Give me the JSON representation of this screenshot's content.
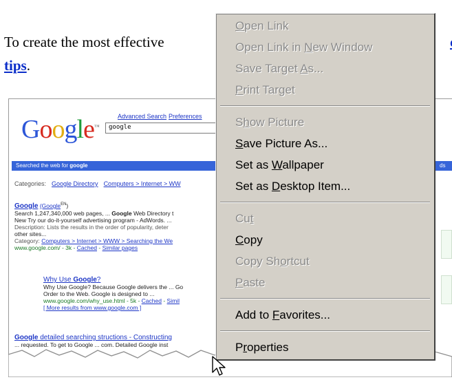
{
  "article": {
    "intro": "To create the most effective",
    "link_right": "or",
    "link_tips": "tips",
    "period": "."
  },
  "screenshot": {
    "logo_letters": [
      "G",
      "o",
      "o",
      "g",
      "l",
      "e"
    ],
    "tm": "™",
    "advanced_search": "Advanced Search",
    "preferences": "Preferences",
    "search_value": "google",
    "bar_prefix": "Searched the web for ",
    "bar_term": "google",
    "bar_right": "ds",
    "categories_label": "Categories:",
    "categories": [
      "Google Directory",
      "Computers > Internet > WW"
    ],
    "result1": {
      "title": "Google",
      "title_paren": "(Google",
      "title_sup": "EN",
      "line1_a": "Search 1,247,340,000 web pages, ... ",
      "line1_b": "Google",
      "line1_c": " Web Directory t",
      "line2": "New Try our do-it-yourself advertising program - AdWords. ...",
      "line3": "Description: Lists the results in the order of popularity, deter",
      "line4": "other sites...",
      "cat_label": "Category: ",
      "cat_link": "Computers > Internet > WWW > Searching the We",
      "url": "www.google.com/ - 3k - ",
      "cached": "Cached",
      "similar": "Similar pages"
    },
    "result2": {
      "title_a": "Why Use ",
      "title_b": "Google",
      "title_c": "?",
      "line1": "Why Use Google? Because Google delivers the ... Go",
      "line2": "Order to the Web. Google is designed to ...",
      "url": "www.google.com/why_use.html - 5k - ",
      "cached": "Cached",
      "similar": "Simil",
      "more": "[ More results from www.google.com ]"
    },
    "result3": {
      "title_a": "Google",
      "title_b": " detailed searching structions - Constructing",
      "line1": "... requested. To get to Google ... com. Detailed Google inst"
    }
  },
  "menu": {
    "items": [
      {
        "pre": "",
        "ul": "O",
        "post": "pen Link",
        "disabled": true
      },
      {
        "pre": "Open Link in ",
        "ul": "N",
        "post": "ew Window",
        "disabled": true
      },
      {
        "pre": "Save Target ",
        "ul": "A",
        "post": "s...",
        "disabled": true
      },
      {
        "pre": "",
        "ul": "P",
        "post": "rint Target",
        "disabled": true
      },
      {
        "pre": "S",
        "ul": "h",
        "post": "ow Picture",
        "disabled": true
      },
      {
        "pre": "",
        "ul": "S",
        "post": "ave Picture As...",
        "disabled": false
      },
      {
        "pre": "Set as ",
        "ul": "W",
        "post": "allpaper",
        "disabled": false
      },
      {
        "pre": "Set as ",
        "ul": "D",
        "post": "esktop Item...",
        "disabled": false
      },
      {
        "pre": "Cu",
        "ul": "t",
        "post": "",
        "disabled": true
      },
      {
        "pre": "",
        "ul": "C",
        "post": "opy",
        "disabled": false
      },
      {
        "pre": "Copy Sh",
        "ul": "o",
        "post": "rtcut",
        "disabled": true
      },
      {
        "pre": "",
        "ul": "P",
        "post": "aste",
        "disabled": true
      },
      {
        "pre": "Add to ",
        "ul": "F",
        "post": "avorites...",
        "disabled": false
      },
      {
        "pre": "P",
        "ul": "r",
        "post": "operties",
        "disabled": false
      }
    ]
  },
  "colors": {
    "link": "#0b2ec9",
    "google_bar": "#3664d9",
    "menu_bg": "#d4d0c8",
    "disabled_text": "#8a8a8a"
  },
  "icons": {
    "cursor": "arrow-cursor-icon"
  }
}
